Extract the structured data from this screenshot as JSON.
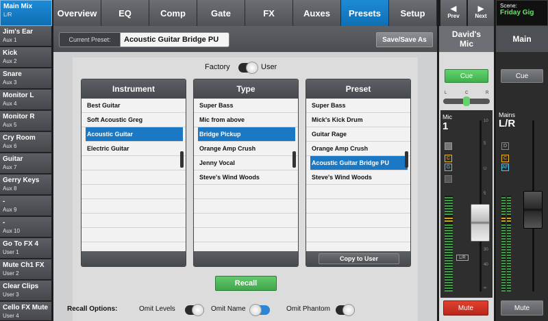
{
  "sidebar": {
    "items": [
      {
        "name": "Main Mix",
        "sub": "L/R"
      },
      {
        "name": "Jim's Ear",
        "sub": "Aux 1"
      },
      {
        "name": "Kick",
        "sub": "Aux 2"
      },
      {
        "name": "Snare",
        "sub": "Aux 3"
      },
      {
        "name": "Monitor L",
        "sub": "Aux 4"
      },
      {
        "name": "Monitor R",
        "sub": "Aux 5"
      },
      {
        "name": "Cry Room",
        "sub": "Aux 6"
      },
      {
        "name": "Guitar",
        "sub": "Aux 7"
      },
      {
        "name": "Gerry Keys",
        "sub": "Aux 8"
      },
      {
        "name": "-",
        "sub": "Aux 9"
      },
      {
        "name": "-",
        "sub": "Aux 10"
      },
      {
        "name": "Go To FX 4",
        "sub": "User 1"
      },
      {
        "name": "Mute Ch1 FX",
        "sub": "User 2"
      },
      {
        "name": "Clear Clips",
        "sub": "User 3"
      },
      {
        "name": "Cello FX Mute",
        "sub": "User 4"
      }
    ]
  },
  "tabs": [
    "Overview",
    "EQ",
    "Comp",
    "Gate",
    "FX",
    "Auxes",
    "Presets",
    "Setup"
  ],
  "nav": {
    "prev": "Prev",
    "next": "Next"
  },
  "scene": {
    "label": "Scene:",
    "value": "Friday Gig"
  },
  "preset": {
    "current_label": "Current Preset:",
    "current_value": "Acoustic Guitar Bridge PU",
    "save_label": "Save/Save As",
    "toggle_left": "Factory",
    "toggle_right": "User"
  },
  "lists": {
    "instrument": {
      "header": "Instrument",
      "items": [
        "Best Guitar",
        "Soft Acoustic Greg",
        "Acoustic Guitar",
        "Electric Guitar"
      ]
    },
    "type": {
      "header": "Type",
      "items": [
        "Super Bass",
        "Mic from above",
        "Bridge Pickup",
        "Orange Amp Crush",
        "Jenny Vocal",
        "Steve's Wind Woods"
      ]
    },
    "preset": {
      "header": "Preset",
      "items": [
        "Super Bass",
        "Mick's Kick Drum",
        "Guitar Rage",
        "Orange Amp Crush",
        "Acoustic Guitar Bridge PU",
        "Steve's Wind Woods"
      ],
      "copy_label": "Copy to User"
    }
  },
  "recall": {
    "button": "Recall",
    "options_title": "Recall Options:",
    "omit_levels": "Omit Levels",
    "omit_name": "Omit Name",
    "omit_phantom": "Omit Phantom"
  },
  "channel": {
    "name_line1": "David's",
    "name_line2": "Mic",
    "cue": "Cue",
    "pan_l": "L",
    "pan_c": "C",
    "pan_r": "R",
    "type": "Mic",
    "number": "1",
    "mute": "Mute",
    "lr_tag": "L/R",
    "badges": [
      "C",
      "G"
    ],
    "scale": [
      "10",
      "5",
      "U",
      "5",
      "10",
      "20",
      "30",
      "40",
      "∞"
    ]
  },
  "mains": {
    "title": "Main",
    "cue": "Cue",
    "label_top": "Mains",
    "label_big": "L/R",
    "badges": [
      "D",
      "C",
      "AF"
    ],
    "mute": "Mute"
  }
}
